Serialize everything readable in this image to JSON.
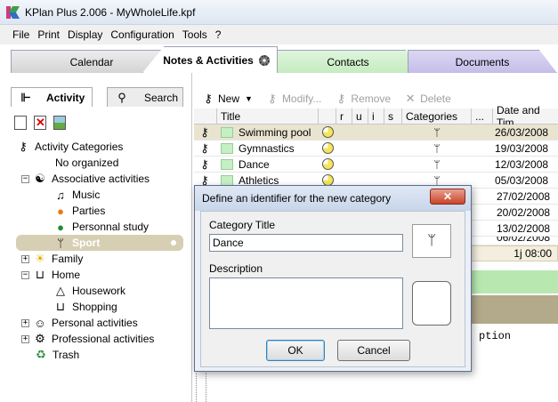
{
  "window": {
    "title": "KPlan Plus 2.006 - MyWholeLife.kpf"
  },
  "menu": [
    "File",
    "Print",
    "Display",
    "Configuration",
    "Tools",
    "?"
  ],
  "tabs": {
    "calendar": "Calendar",
    "notes": "Notes & Activities",
    "contacts": "Contacts",
    "documents": "Documents"
  },
  "left": {
    "activity_tab": "Activity",
    "search_tab": "Search",
    "tree": [
      {
        "label": "Activity Categories",
        "icon": "key-icon"
      },
      {
        "label": "No organized",
        "icon": "none"
      },
      {
        "label": "Associative activities",
        "icon": "yin-yang-icon",
        "expander": "−"
      },
      {
        "label": "Music",
        "icon": "music-note-icon"
      },
      {
        "label": "Parties",
        "icon": "pumpkin-icon"
      },
      {
        "label": "Personnal study",
        "icon": "balloon-icon"
      },
      {
        "label": "Sport",
        "icon": "weightlifter-icon"
      },
      {
        "label": "Family",
        "icon": "sun-icon",
        "expander": "+"
      },
      {
        "label": "Home",
        "icon": "cart-icon",
        "expander": "−"
      },
      {
        "label": "Housework",
        "icon": "hanger-icon"
      },
      {
        "label": "Shopping",
        "icon": "cart-icon"
      },
      {
        "label": "Personal activities",
        "icon": "person-icon",
        "expander": "+"
      },
      {
        "label": "Professional activities",
        "icon": "gear-icon",
        "expander": "+"
      },
      {
        "label": "Trash",
        "icon": "trash-icon"
      }
    ]
  },
  "toolbar": {
    "new": "New",
    "modify": "Modify...",
    "remove": "Remove",
    "delete": "Delete"
  },
  "grid": {
    "headers": [
      "Title",
      "r",
      "u",
      "i",
      "s",
      "Categories",
      "...",
      "Date and Tim"
    ],
    "rows": [
      {
        "title": "Swimming pool",
        "date": "26/03/2008"
      },
      {
        "title": "Gymnastics",
        "date": "19/03/2008"
      },
      {
        "title": "Dance",
        "date": "12/03/2008"
      },
      {
        "title": "Athletics",
        "date": "05/03/2008"
      },
      {
        "title": "",
        "date": "27/02/2008"
      },
      {
        "title": "",
        "date": "20/02/2008"
      },
      {
        "title": "",
        "date": "13/02/2008"
      },
      {
        "title": "",
        "date": "06/02/2008"
      }
    ],
    "total": "1j 08:00",
    "desc_fragment": "ption"
  },
  "dialog": {
    "title": "Define an identifier for the new category",
    "close": "✕",
    "category_title_label": "Category Title",
    "category_title_value": "Dance",
    "description_label": "Description",
    "ok": "OK",
    "cancel": "Cancel"
  }
}
